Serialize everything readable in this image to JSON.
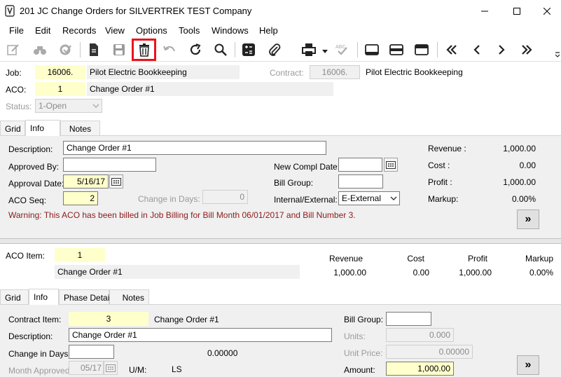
{
  "window": {
    "title": "201 JC Change Orders for SILVERTREK TEST Company"
  },
  "menu": [
    "File",
    "Edit",
    "Records",
    "View",
    "Options",
    "Tools",
    "Windows",
    "Help"
  ],
  "header": {
    "job_label": "Job:",
    "job_value": "16006.",
    "job_desc": "Pilot Electric Bookkeeping",
    "contract_label": "Contract:",
    "contract_value": "16006.",
    "contract_desc": "Pilot Electric Bookkeeping",
    "aco_label": "ACO:",
    "aco_value": "1",
    "aco_desc": "Change Order #1",
    "status_label": "Status:",
    "status_value": "1-Open"
  },
  "tabs_top": [
    "Grid",
    "Info",
    "Notes"
  ],
  "info": {
    "description_label": "Description:",
    "description_value": "Change Order #1",
    "approved_by_label": "Approved By:",
    "approved_by_value": "",
    "approval_date_label": "Approval Date:",
    "approval_date_value": "5/16/17",
    "aco_seq_label": "ACO Seq:",
    "aco_seq_value": "2",
    "change_days_label": "Change in Days:",
    "change_days_value": "0",
    "new_compl_label": "New Compl Date:",
    "new_compl_value": "",
    "bill_group_label": "Bill Group:",
    "bill_group_value": "",
    "internal_label": "Internal/External:",
    "internal_value": "E-External",
    "warning": "Warning: This ACO has been billed in Job Billing for Bill Month 06/01/2017 and Bill Number 3.",
    "revenue_label": "Revenue  :",
    "revenue_value": "1,000.00",
    "cost_label": "Cost  :",
    "cost_value": "0.00",
    "profit_label": "Profit  :",
    "profit_value": "1,000.00",
    "markup_label": "Markup:",
    "markup_value": "0.00%",
    "more_label": "»"
  },
  "item": {
    "aco_item_label": "ACO Item:",
    "aco_item_value": "1",
    "aco_item_desc": "Change Order #1",
    "col_revenue": "Revenue",
    "col_cost": "Cost",
    "col_profit": "Profit",
    "col_markup": "Markup",
    "revenue": "1,000.00",
    "cost": "0.00",
    "profit": "1,000.00",
    "markup": "0.00%"
  },
  "tabs_bottom": [
    "Grid",
    "Info",
    "Phase Detail",
    "Notes"
  ],
  "item_info": {
    "contract_item_label": "Contract Item:",
    "contract_item_value": "3",
    "contract_item_desc": "Change Order #1",
    "description_label": "Description:",
    "description_value": "Change Order #1",
    "change_days_label": "Change in Days:",
    "change_days_value": "",
    "change_days_extra": "0.00000",
    "month_approved_label": "Month Approved:",
    "month_approved_value": "05/17",
    "um_label": "U/M:",
    "um_value": "LS",
    "bill_group_label": "Bill Group:",
    "bill_group_value": "",
    "units_label": "Units:",
    "units_value": "0.000",
    "unit_price_label": "Unit Price:",
    "unit_price_value": "0.00000",
    "amount_label": "Amount:",
    "amount_value": "1,000.00",
    "more_label": "»"
  },
  "colors": {
    "highlight": "#e8141c",
    "yellow_field": "#ffffcc",
    "panel_bg": "#f0f0f0",
    "warning_text": "#8b1a1a"
  }
}
